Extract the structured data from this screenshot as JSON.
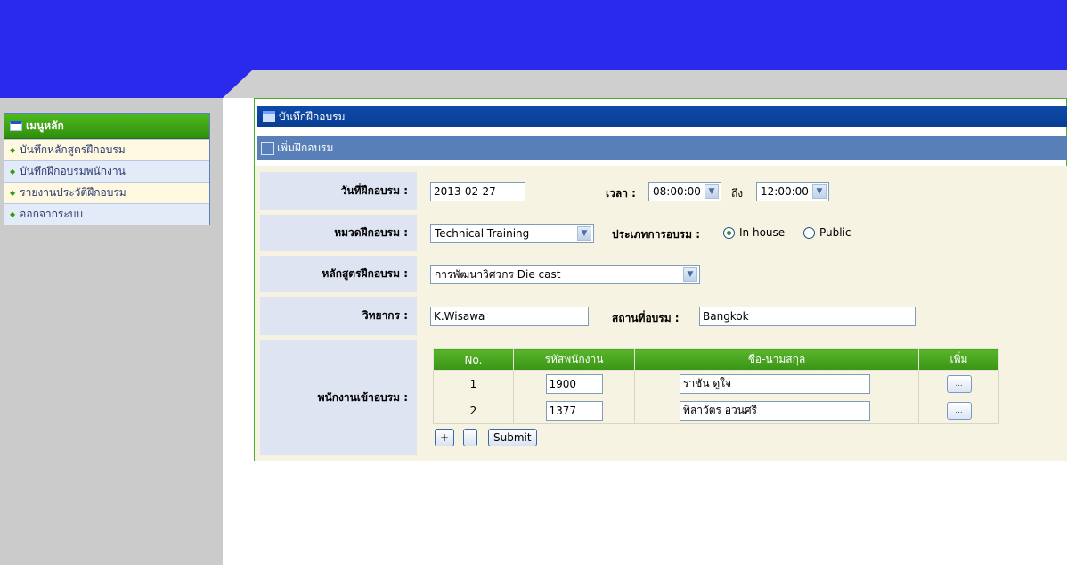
{
  "menu": {
    "title": "เมนูหลัก",
    "items": [
      {
        "label": "บันทึกหลักสูตรฝึกอบรม"
      },
      {
        "label": "บันทึกฝึกอบรมพนักงาน"
      },
      {
        "label": "รายงานประวัติฝึกอบรม"
      },
      {
        "label": "ออกจากระบบ"
      }
    ]
  },
  "panel": {
    "title": "บันทึกฝึกอบรม",
    "subtitle": "เพิ่มฝึกอบรม"
  },
  "form": {
    "date_label": "วันที่ฝึกอบรม :",
    "date_value": "2013-02-27",
    "time_label": "เวลา :",
    "time_from": "08:00:00",
    "time_to_label": "ถึง",
    "time_to": "12:00:00",
    "category_label": "หมวดฝึกอบรม :",
    "category_value": "Technical Training",
    "type_label": "ประเภทการอบรม :",
    "type_options": [
      {
        "label": "In house",
        "selected": true
      },
      {
        "label": "Public",
        "selected": false
      }
    ],
    "course_label": "หลักสูตรฝึกอบรม :",
    "course_value": "การพัฒนาวิศวกร Die cast",
    "trainer_label": "วิทยากร :",
    "trainer_value": "K.Wisawa",
    "location_label": "สถานที่อบรม :",
    "location_value": "Bangkok",
    "employees_label": "พนักงานเข้าอบรม :"
  },
  "employee_table": {
    "headers": [
      "No.",
      "รหัสพนักงาน",
      "ชื่อ-นามสกุล",
      "เพิ่ม"
    ],
    "rows": [
      {
        "no": "1",
        "code": "1900",
        "name": "ราชัน ดูใจ",
        "button": "..."
      },
      {
        "no": "2",
        "code": "1377",
        "name": "พิลาวัตร อวนศรี",
        "button": "..."
      }
    ]
  },
  "buttons": {
    "add": "+",
    "remove": "-",
    "submit": "Submit"
  },
  "colors": {
    "header_blue": "#2a2aec",
    "menu_green": "#3a9a18",
    "panel_title_blue": "#0c46a2",
    "form_bg": "#f6f3e2"
  }
}
